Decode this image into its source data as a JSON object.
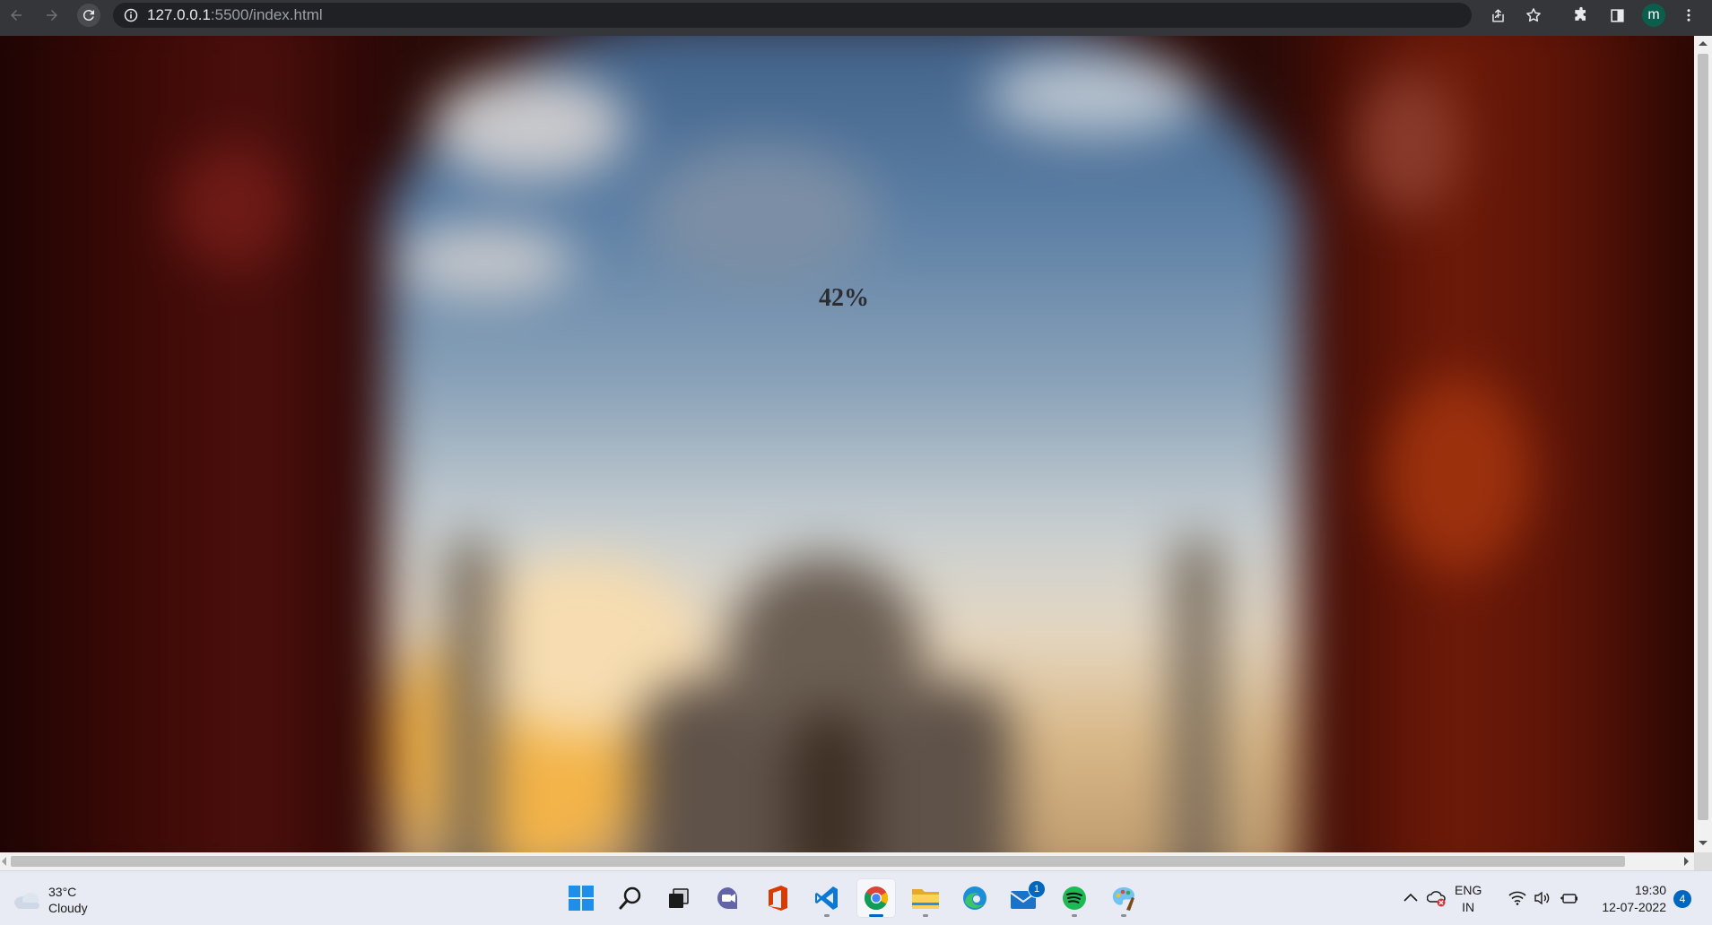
{
  "browser": {
    "url_host": "127.0.0.1",
    "url_rest": ":5500/index.html",
    "profile_initial": "m",
    "accent_color": "#0b5e4b"
  },
  "page": {
    "progress_text": "42%",
    "progress_value": 42
  },
  "taskbar": {
    "weather": {
      "temperature": "33°C",
      "condition": "Cloudy",
      "icon": "cloud-icon"
    },
    "apps": [
      {
        "name": "start",
        "icon": "windows-logo-icon"
      },
      {
        "name": "search",
        "icon": "search-icon"
      },
      {
        "name": "task-view",
        "icon": "task-view-icon"
      },
      {
        "name": "teams-chat",
        "icon": "chat-icon"
      },
      {
        "name": "office",
        "icon": "office-icon"
      },
      {
        "name": "vs-code",
        "icon": "vscode-icon"
      },
      {
        "name": "chrome",
        "icon": "chrome-icon",
        "active": true
      },
      {
        "name": "file-explorer",
        "icon": "folder-icon"
      },
      {
        "name": "edge",
        "icon": "edge-icon"
      },
      {
        "name": "mail",
        "icon": "mail-icon",
        "badge": "1"
      },
      {
        "name": "spotify",
        "icon": "spotify-icon"
      },
      {
        "name": "paint",
        "icon": "palette-icon"
      }
    ],
    "language": {
      "line1": "ENG",
      "line2": "IN"
    },
    "clock": {
      "time": "19:30",
      "date": "12-07-2022"
    },
    "notification_count": "4",
    "mail_badge": "1"
  }
}
